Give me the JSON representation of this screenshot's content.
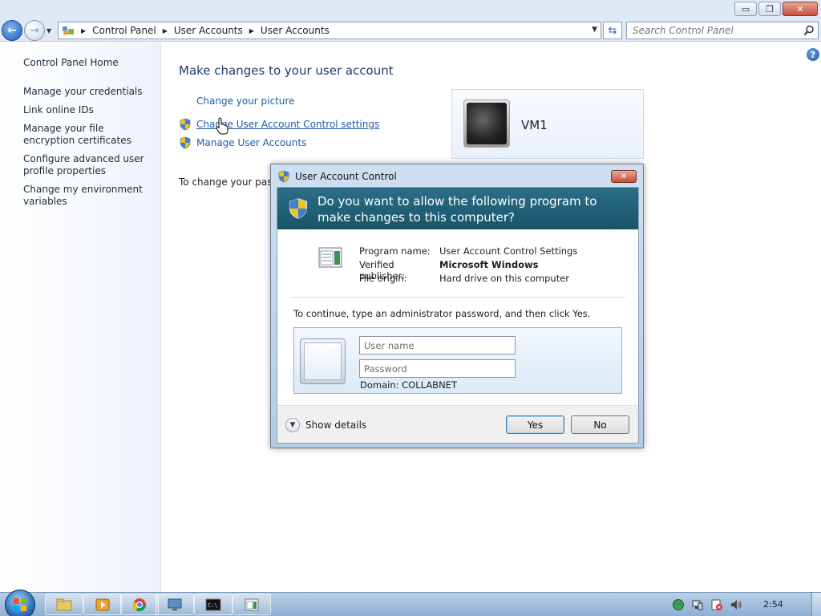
{
  "window": {
    "minimize_glyph": "▭",
    "maximize_glyph": "❐",
    "close_glyph": "✕"
  },
  "nav": {
    "back_glyph": "←",
    "forward_glyph": "→",
    "breadcrumb": [
      "Control Panel",
      "User Accounts",
      "User Accounts"
    ],
    "search_placeholder": "Search Control Panel"
  },
  "sidebar": {
    "home": "Control Panel Home",
    "items": [
      {
        "label": "Manage your credentials"
      },
      {
        "label": "Link online IDs"
      },
      {
        "label": "Manage your file encryption certificates"
      },
      {
        "label": "Configure advanced user profile properties"
      },
      {
        "label": "Change my environment variables"
      }
    ]
  },
  "main": {
    "title": "Make changes to your user account",
    "tasks": {
      "change_picture": "Change your picture",
      "change_uac": "Change User Account Control settings",
      "manage_accounts": "Manage User Accounts"
    },
    "password_note": "To change your passv",
    "user": {
      "name": "VM1"
    },
    "help_glyph": "?"
  },
  "uac": {
    "title": "User Account Control",
    "question": "Do you want to allow the following program to make changes to this computer?",
    "program_name_label": "Program name:",
    "program_name": "User Account Control Settings",
    "publisher_label": "Verified publisher:",
    "publisher": "Microsoft Windows",
    "origin_label": "File origin:",
    "origin": "Hard drive on this computer",
    "instruction": "To continue, type an administrator password, and then click Yes.",
    "username_placeholder": "User name",
    "password_placeholder": "Password",
    "domain": "Domain: COLLABNET",
    "show_details": "Show details",
    "yes": "Yes",
    "no": "No",
    "close_glyph": "✕"
  },
  "taskbar": {
    "clock": "2:54"
  },
  "colors": {
    "link": "#1e5aa8",
    "banner": "#1f6078",
    "heading": "#1e3c6e"
  }
}
